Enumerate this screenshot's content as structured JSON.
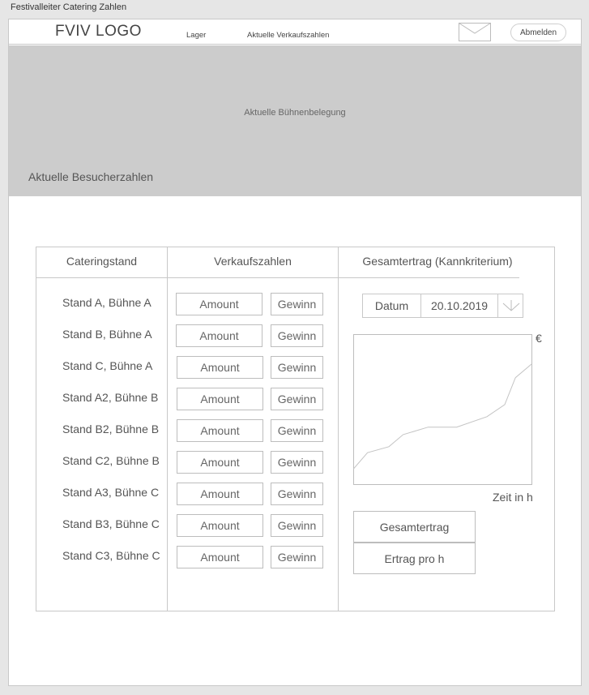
{
  "window": {
    "title": "Festivalleiter Catering Zahlen"
  },
  "header": {
    "logo": "FVIV LOGO",
    "nav": [
      {
        "label": "Lager"
      },
      {
        "label": "Aktuelle Verkaufszahlen"
      }
    ],
    "mail_icon": "mail-icon",
    "logout_label": "Abmelden"
  },
  "banner": {
    "stage_text": "Aktuelle Bühnenbelegung",
    "visitors_text": "Aktuelle Besucherzahlen"
  },
  "table": {
    "headers": [
      "Cateringstand",
      "Verkaufszahlen",
      "Gesamtertrag (Kannkriterium)"
    ],
    "rows": [
      {
        "stand": "Stand A, Bühne A",
        "amount": "Amount",
        "gewinn": "Gewinn"
      },
      {
        "stand": "Stand B, Bühne A",
        "amount": "Amount",
        "gewinn": "Gewinn"
      },
      {
        "stand": "Stand C, Bühne A",
        "amount": "Amount",
        "gewinn": "Gewinn"
      },
      {
        "stand": "Stand A2, Bühne B",
        "amount": "Amount",
        "gewinn": "Gewinn"
      },
      {
        "stand": "Stand B2, Bühne B",
        "amount": "Amount",
        "gewinn": "Gewinn"
      },
      {
        "stand": "Stand C2, Bühne B",
        "amount": "Amount",
        "gewinn": "Gewinn"
      },
      {
        "stand": "Stand A3, Bühne C",
        "amount": "Amount",
        "gewinn": "Gewinn"
      },
      {
        "stand": "Stand B3, Bühne C",
        "amount": "Amount",
        "gewinn": "Gewinn"
      },
      {
        "stand": "Stand C3, Bühne C",
        "amount": "Amount",
        "gewinn": "Gewinn"
      }
    ]
  },
  "revenue": {
    "date_label": "Datum",
    "date_value": "20.10.2019",
    "dropdown_icon": "arrow-down-icon",
    "chart_unit": "€",
    "chart_xlabel": "Zeit in h",
    "buttons": [
      "Gesamtertrag",
      "Ertrag pro h"
    ]
  },
  "chart_data": {
    "type": "line",
    "xlabel": "Zeit in h",
    "ylabel": "€",
    "series": [
      {
        "values": [
          [
            0,
            10
          ],
          [
            8,
            21
          ],
          [
            20,
            25
          ],
          [
            28,
            33
          ],
          [
            42,
            38
          ],
          [
            58,
            38
          ],
          [
            75,
            45
          ],
          [
            85,
            53
          ],
          [
            91,
            71
          ],
          [
            100,
            80
          ]
        ]
      }
    ]
  }
}
